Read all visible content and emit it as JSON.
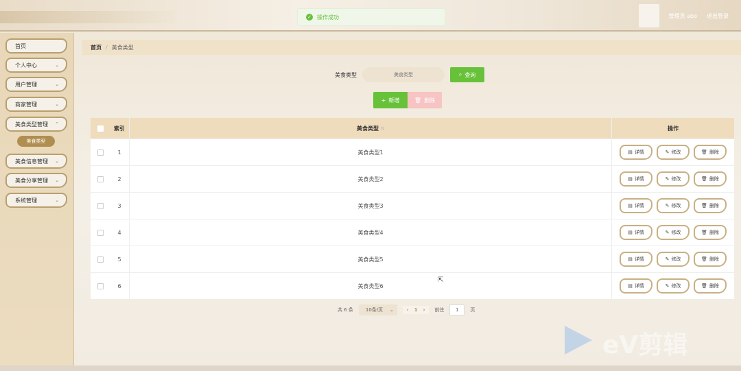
{
  "header": {
    "toast": "操作成功",
    "user_label": "管理员 abo",
    "logout": "退出登录"
  },
  "sidebar": {
    "items": [
      {
        "label": "首页"
      },
      {
        "label": "个人中心"
      },
      {
        "label": "用户管理"
      },
      {
        "label": "商家管理"
      },
      {
        "label": "美食类型管理"
      },
      {
        "label": "美食信息管理"
      },
      {
        "label": "美食分享管理"
      },
      {
        "label": "系统管理"
      }
    ],
    "active_sub": "美食类型"
  },
  "breadcrumb": {
    "home": "首页",
    "sep": "/",
    "current": "美食类型"
  },
  "search": {
    "label": "美食类型",
    "placeholder": "美食类型",
    "button": "查询"
  },
  "actions": {
    "add": "新增",
    "delete": "删除"
  },
  "table": {
    "headers": {
      "index": "索引",
      "name": "美食类型",
      "ops": "操作"
    },
    "rows": [
      {
        "index": "1",
        "name": "美食类型1"
      },
      {
        "index": "2",
        "name": "美食类型2"
      },
      {
        "index": "3",
        "name": "美食类型3"
      },
      {
        "index": "4",
        "name": "美食类型4"
      },
      {
        "index": "5",
        "name": "美食类型5"
      },
      {
        "index": "6",
        "name": "美食类型6"
      }
    ],
    "ops": {
      "detail": "详情",
      "edit": "修改",
      "delete": "删除"
    }
  },
  "pagination": {
    "total": "共 6 条",
    "page_size": "10条/页",
    "current": "1",
    "goto": "前往",
    "goto_value": "1",
    "page_unit": "页"
  },
  "watermark": {
    "text": "eV剪辑"
  },
  "icons": {
    "toast": "check-circle-icon",
    "search": "search-icon",
    "add": "plus-icon",
    "delete": "trash-icon",
    "detail": "document-icon",
    "edit": "pencil-icon",
    "chevron": "chevron-down-icon",
    "cursor": "mouse-pointer-icon"
  },
  "colors": {
    "accent": "#b08e4f",
    "success": "#67c23a",
    "danger_light": "#f7c3c3"
  }
}
